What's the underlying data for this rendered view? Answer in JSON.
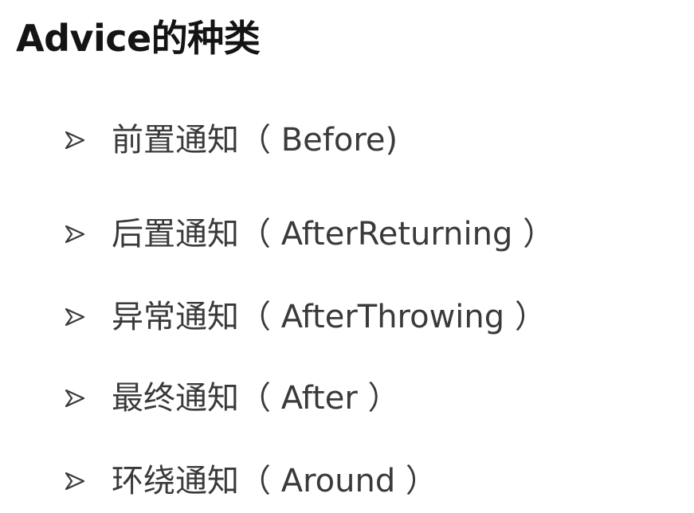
{
  "title": "Advice的种类",
  "items": [
    {
      "label": "前置通知（ Before)"
    },
    {
      "label": "后置通知（ AfterReturning ）"
    },
    {
      "label": "异常通知（ AfterThrowing ）"
    },
    {
      "label": "最终通知（ After ）"
    },
    {
      "label": "环绕通知（ Around ）"
    }
  ],
  "colors": {
    "title": "#141414",
    "text": "#3a3a3a",
    "bullet": "#3a3a3a",
    "background": "#ffffff"
  },
  "icons": {
    "bullet": "arrowhead-bullet-icon"
  }
}
